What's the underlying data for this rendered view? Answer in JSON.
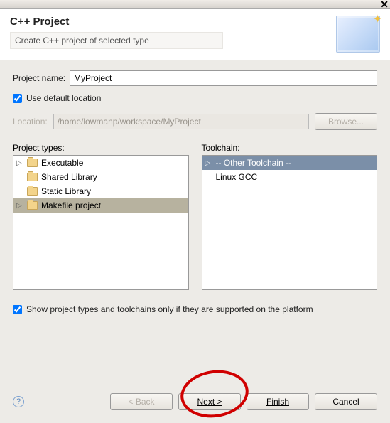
{
  "titlebar": {
    "close": "✕"
  },
  "header": {
    "title": "C++ Project",
    "subtitle": "Create C++ project of selected type"
  },
  "form": {
    "project_name_label": "Project name:",
    "project_name_value": "MyProject",
    "use_default_label": "Use default location",
    "use_default_checked": true,
    "location_label": "Location:",
    "location_value": "/home/lowmanp/workspace/MyProject",
    "browse_label": "Browse..."
  },
  "project_types": {
    "label": "Project types:",
    "items": [
      {
        "label": "Executable",
        "expandable": true
      },
      {
        "label": "Shared Library",
        "expandable": false
      },
      {
        "label": "Static Library",
        "expandable": false
      },
      {
        "label": "Makefile project",
        "expandable": true,
        "selected": true
      }
    ]
  },
  "toolchain": {
    "label": "Toolchain:",
    "items": [
      {
        "label": "-- Other Toolchain --",
        "selected": true
      },
      {
        "label": "Linux GCC"
      }
    ]
  },
  "show_supported": {
    "label": "Show project types and toolchains only if they are supported on the platform",
    "checked": true
  },
  "buttons": {
    "back": "< Back",
    "next": "Next >",
    "finish": "Finish",
    "cancel": "Cancel"
  }
}
